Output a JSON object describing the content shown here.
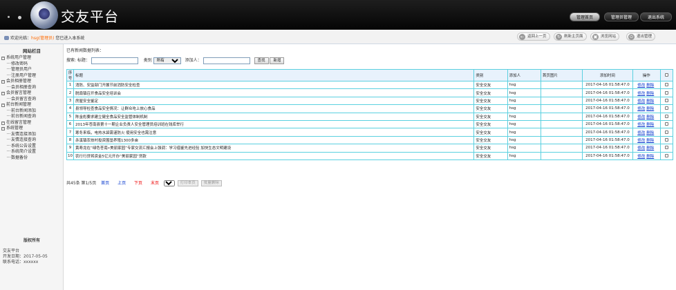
{
  "header": {
    "title": "交友平台",
    "buttons": [
      {
        "label": "管理首页",
        "active": true
      },
      {
        "label": "管理员管理",
        "active": false
      },
      {
        "label": "退出系统",
        "active": false
      }
    ]
  },
  "topbar": {
    "welcome_prefix": "欢迎光临：",
    "user": "hsg(管理员)",
    "welcome_suffix": " 您已进入本系统",
    "tools": [
      {
        "icon": "back-icon",
        "label": "返回上一页"
      },
      {
        "icon": "refresh-icon",
        "label": "刷新主页面"
      },
      {
        "icon": "browser-icon",
        "label": "浏览网站"
      },
      {
        "icon": "logout-icon",
        "label": "退出管理"
      }
    ]
  },
  "sidebar": {
    "title": "网站栏目",
    "tree": [
      {
        "type": "group",
        "label": "系统用户管理"
      },
      {
        "type": "leaf",
        "label": "修改密码"
      },
      {
        "type": "leaf",
        "label": "管理员用户"
      },
      {
        "type": "leaf",
        "label": "注册用户管理"
      },
      {
        "type": "group",
        "label": "会员相册管理"
      },
      {
        "type": "leaf",
        "label": "会员相册查询"
      },
      {
        "type": "group",
        "label": "会员留言管理"
      },
      {
        "type": "leaf",
        "label": "会员留言查询"
      },
      {
        "type": "group",
        "label": "前台新闻管理"
      },
      {
        "type": "leaf",
        "label": "前台新闻添加"
      },
      {
        "type": "leaf",
        "label": "前台新闻查询"
      },
      {
        "type": "group",
        "label": "在线留言管理"
      },
      {
        "type": "group",
        "label": "系统管理"
      },
      {
        "type": "leaf",
        "label": "友情连接添加"
      },
      {
        "type": "leaf",
        "label": "友情连接查询"
      },
      {
        "type": "leaf",
        "label": "系统公告设置"
      },
      {
        "type": "leaf",
        "label": "系统简介设置"
      },
      {
        "type": "leaf",
        "label": "数据备份"
      }
    ],
    "copyright": "版权所有",
    "info": [
      "交友平台",
      "开发日期：2017-05-05",
      "联系电话：xxxxxx"
    ]
  },
  "main": {
    "list_caption": "已有新闻数据列表：",
    "search": {
      "label": "搜索: 标题：",
      "title_value": "",
      "category_label": "类别",
      "category_value": "所有",
      "adder_label": "添加人：",
      "adder_value": "",
      "search_button": "查找",
      "add_button": "新增"
    },
    "columns": [
      "序号",
      "标题",
      "类别",
      "添加人",
      "首页图片",
      "添加时间",
      "操作",
      ""
    ],
    "rows": [
      {
        "no": "1",
        "title": "消防、安监部门开展节前消防安全检查",
        "category": "安全交友",
        "adder": "hsg",
        "image": "",
        "time": "2017-04-16 01:58:47.0"
      },
      {
        "no": "2",
        "title": "脱扇镇召开食品安全培训会",
        "category": "安全交友",
        "adder": "hsg",
        "image": "",
        "time": "2017-04-16 01:58:47.0"
      },
      {
        "no": "3",
        "title": "房屋安全鉴定",
        "category": "安全交友",
        "adder": "hsg",
        "image": "",
        "time": "2017-04-16 01:58:47.0"
      },
      {
        "no": "4",
        "title": "县领导检查食品安全情况：让群众吃上放心食品",
        "category": "安全交友",
        "adder": "hsg",
        "image": "",
        "time": "2017-04-16 01:58:47.0"
      },
      {
        "no": "5",
        "title": "陈金彪要求建立健全食品安全监管体制机制",
        "category": "安全交友",
        "adder": "hsg",
        "image": "",
        "time": "2017-04-16 01:58:47.0"
      },
      {
        "no": "6",
        "title": "2013年苍南县第十一期企业负责人安全管理员培训班在钱库举行",
        "category": "安全交友",
        "adder": "hsg",
        "image": "",
        "time": "2017-04-16 01:58:47.0"
      },
      {
        "no": "7",
        "title": "寒冬来临，电热水袋需谨防火 使用安全也需注意",
        "category": "安全交友",
        "adder": "hsg",
        "image": "",
        "time": "2017-04-16 01:58:47.0"
      },
      {
        "no": "8",
        "title": "赤溪镇农技村投资围垦养殖1300多亩",
        "category": "安全交友",
        "adder": "hsg",
        "image": "",
        "time": "2017-04-16 01:58:47.0"
      },
      {
        "no": "9",
        "title": "黄寿龙在“绿色苍南•美丽家园”专家交流汇报会上强调：学习借鉴先进经验 加快生态文明建设",
        "category": "安全交友",
        "adder": "hsg",
        "image": "",
        "time": "2017-04-16 01:58:47.0"
      },
      {
        "no": "10",
        "title": "农行行贷将资金5亿元开办“美丽家园”贷款",
        "category": "安全交友",
        "adder": "hsg",
        "image": "",
        "time": "2017-04-16 01:58:47.0"
      }
    ],
    "edit_link": "修改",
    "delete_link": "删除",
    "pager": {
      "summary": "共45条 第1/5页",
      "first": "首页",
      "prev": "上页",
      "next": "下页",
      "last": "末页",
      "page_value": "1",
      "print_button": "打印本页",
      "batch_delete_button": "批量删除"
    }
  }
}
